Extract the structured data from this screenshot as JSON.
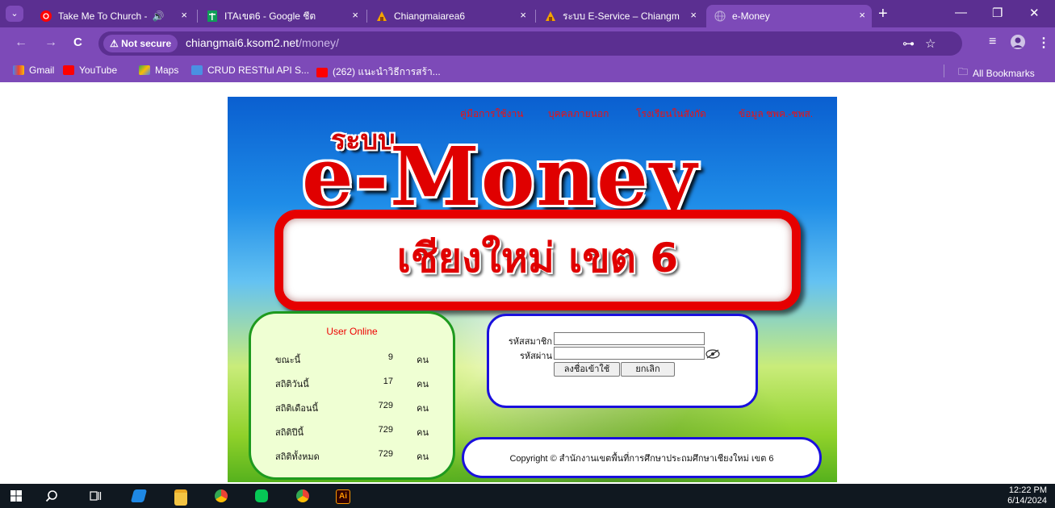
{
  "browser": {
    "tabs": [
      {
        "title": "Take Me To Church -",
        "icon": "youtube-music-icon",
        "extra": "🔊",
        "active": false
      },
      {
        "title": "ITAเขต6 - Google ชีต",
        "icon": "sheets-icon",
        "active": false
      },
      {
        "title": "Chiangmaiarea6",
        "icon": "site-favicon",
        "active": false
      },
      {
        "title": "ระบบ E-Service – Chiangm",
        "icon": "site-favicon",
        "active": false
      },
      {
        "title": "e-Money",
        "icon": "globe-icon",
        "active": true
      }
    ],
    "tab_close": "×",
    "new_tab": "+",
    "window_controls": {
      "minimize": "—",
      "restore": "❐",
      "close": "✕"
    },
    "nav": {
      "back": "←",
      "forward": "→",
      "reload": "C"
    },
    "security_label": "Not secure",
    "url_domain": "chiangmai6.ksom2.net",
    "url_path": "/money/",
    "bookmarks": [
      {
        "label": "Gmail",
        "color": "#ea4335"
      },
      {
        "label": "YouTube",
        "color": "#ff0000"
      },
      {
        "label": "Maps",
        "color": "#34a853"
      },
      {
        "label": "CRUD RESTful API S...",
        "color": "#4a90e2"
      },
      {
        "label": "(262) แนะนำวิธีการสร้า...",
        "color": "#ff0000"
      }
    ],
    "all_bookmarks": "All Bookmarks"
  },
  "site": {
    "top_nav": [
      "คู่มือการใช้งาน",
      "บุคคลภายนอก",
      "โรงเรียนในสังกัด",
      "ข้อมูล ชพค.-ชพส."
    ],
    "system_label": "ระบบ",
    "logo_text": "e-Money",
    "area_text": "เชียงใหม่ เขต 6",
    "stats": {
      "title": "User Online",
      "rows": [
        {
          "label": "ขณะนี้",
          "value": "9",
          "unit": "คน"
        },
        {
          "label": "สถิติวันนี้",
          "value": "17",
          "unit": "คน"
        },
        {
          "label": "สถิติเดือนนี้",
          "value": "729",
          "unit": "คน"
        },
        {
          "label": "สถิติปีนี้",
          "value": "729",
          "unit": "คน"
        },
        {
          "label": "สถิติทั้งหมด",
          "value": "729",
          "unit": "คน"
        }
      ]
    },
    "login": {
      "member_label": "รหัสสมาชิก",
      "member_value": "",
      "password_label": "รหัสผ่าน",
      "password_value": "",
      "login_button": "ลงชื่อเข้าใช้",
      "cancel_button": "ยกเลิก"
    },
    "copyright": "Copyright © สำนักงานเขตพื้นที่การศึกษาประถมศึกษาเชียงใหม่ เขต 6"
  },
  "taskbar": {
    "time": "12:22 PM",
    "date": "6/14/2024"
  }
}
